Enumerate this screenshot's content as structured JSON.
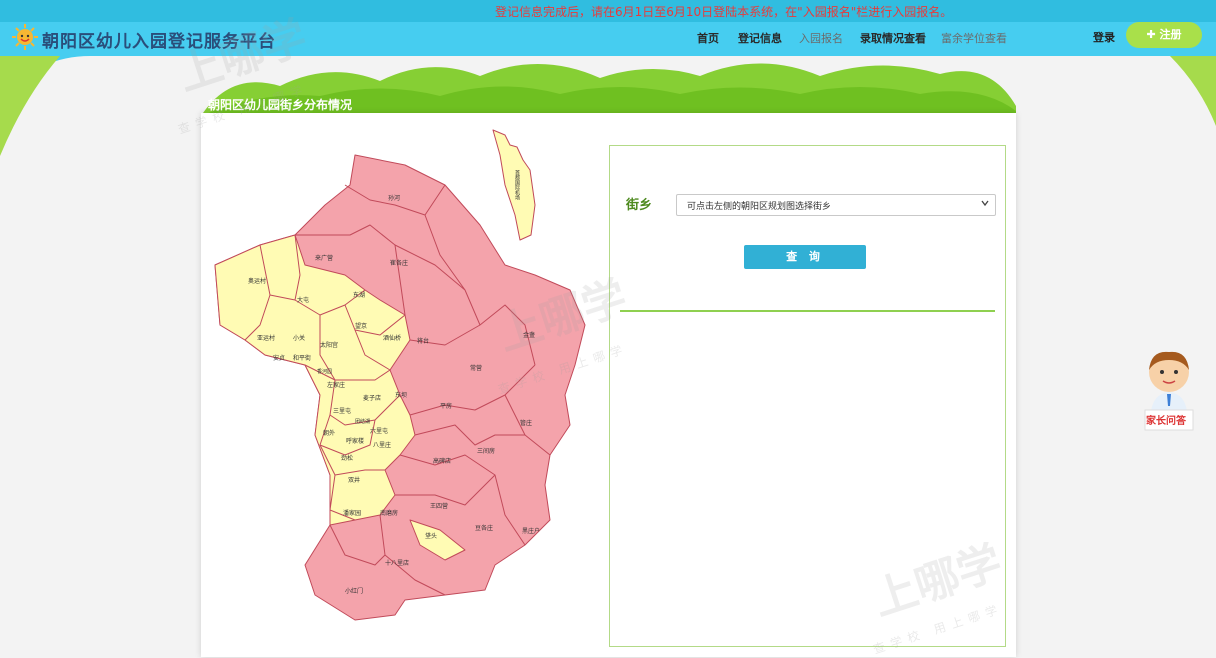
{
  "notice": "登记信息完成后，请在6月1日至6月10日登陆本系统，在\"入园报名\"栏进行入园报名。",
  "header": {
    "title": "朝阳区幼儿入园登记服务平台",
    "nav": [
      {
        "label": "首页"
      },
      {
        "label": "登记信息"
      },
      {
        "label": "入园报名"
      },
      {
        "label": "录取情况查看"
      },
      {
        "label": "富余学位查看"
      }
    ],
    "login": "登录",
    "register": "注册"
  },
  "panel": {
    "title": "朝阳区幼儿园街乡分布情况"
  },
  "search": {
    "label": "街乡",
    "select_value": "可点击左侧的朝阳区规划图选择街乡",
    "button": "查 询"
  },
  "faq": {
    "label": "家长问答"
  },
  "map": {
    "regions": [
      "孙河",
      "首都国际机场",
      "崔各庄",
      "来广营",
      "东湖",
      "望京",
      "奥运村",
      "大屯",
      "亚运村",
      "小关",
      "太阳宫",
      "酒仙桥",
      "将台",
      "金盏",
      "安贞",
      "和平街",
      "左家庄",
      "香河园",
      "麦子店",
      "东坝",
      "三里屯",
      "团结湖",
      "六里屯",
      "八里庄",
      "平房",
      "常营",
      "朝外",
      "呼家楼",
      "高碑店",
      "三间房",
      "管庄",
      "劲松",
      "双井",
      "潘家园",
      "南磨房",
      "王四营",
      "豆各庄",
      "黑庄户",
      "垡头",
      "十八里店",
      "小红门"
    ]
  },
  "watermarks": {
    "main": "上哪学",
    "sub": "查学校 用上哪学"
  },
  "colors": {
    "header": "#46cdf0",
    "notice_text": "#e83b3b",
    "map_urban": "#fffbb4",
    "map_suburb": "#f4a3ab",
    "accent_green": "#8fd050",
    "button": "#31b0d5"
  }
}
